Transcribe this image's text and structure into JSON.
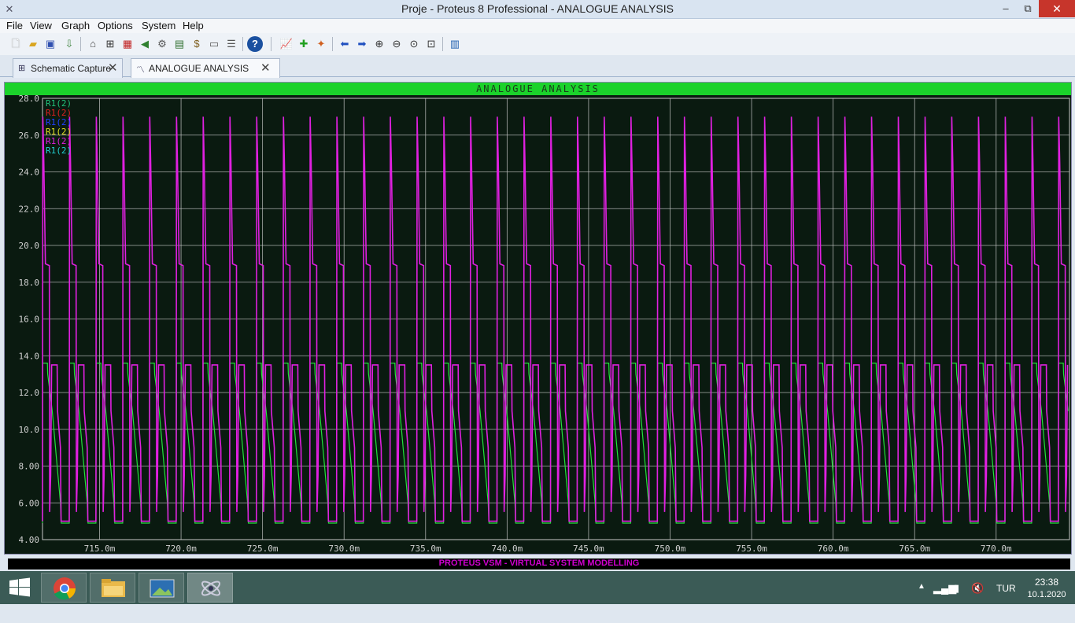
{
  "window": {
    "title": "Proje - Proteus 8 Professional - ANALOGUE ANALYSIS",
    "minimize": "–",
    "maximize": "⧉",
    "close": "✕"
  },
  "menu": [
    "File",
    "View",
    "Graph",
    "Options",
    "System",
    "Help"
  ],
  "tabs": [
    {
      "label": "Schematic Capture",
      "icon": "schematic-icon",
      "active": false
    },
    {
      "label": "ANALOGUE ANALYSIS",
      "icon": "graph-icon",
      "active": true
    }
  ],
  "graph": {
    "title": "ANALOGUE ANALYSIS",
    "background": "#0a1a10",
    "header_color": "#1bd22b",
    "grid_color": "#c8c8c8",
    "legend": [
      {
        "label": "R1(2)",
        "color": "#22c07a"
      },
      {
        "label": "R1(2)",
        "color": "#e02020"
      },
      {
        "label": "R1(2)",
        "color": "#2040ff"
      },
      {
        "label": "R1(2)",
        "color": "#e0e020"
      },
      {
        "label": "R1(2)",
        "color": "#e020e0"
      },
      {
        "label": "R1(2)",
        "color": "#20d0d0"
      }
    ]
  },
  "chart_data": {
    "type": "line",
    "title": "ANALOGUE ANALYSIS",
    "xlim": [
      711.5,
      774.5
    ],
    "ylim": [
      4.0,
      28.0
    ],
    "x_ticks": [
      715,
      720,
      725,
      730,
      735,
      740,
      745,
      750,
      755,
      760,
      765,
      770
    ],
    "x_tick_labels": [
      "715.0m",
      "720.0m",
      "725.0m",
      "730.0m",
      "735.0m",
      "740.0m",
      "745.0m",
      "750.0m",
      "755.0m",
      "760.0m",
      "765.0m",
      "770.0m"
    ],
    "y_ticks": [
      4,
      6,
      8,
      10,
      12,
      14,
      16,
      18,
      20,
      22,
      24,
      26,
      28
    ],
    "y_tick_labels": [
      "4.00",
      "6.00",
      "8.00",
      "10.0",
      "12.0",
      "14.0",
      "16.0",
      "18.0",
      "20.0",
      "22.0",
      "24.0",
      "26.0",
      "28.0"
    ],
    "period": 1.64,
    "series": [
      {
        "name": "R1(2)",
        "color": "#e020e0",
        "levels": {
          "peak": 27.0,
          "plateau": 18.9,
          "low": 5.0
        }
      },
      {
        "name": "R1(2)",
        "color": "#22e03a",
        "levels": {
          "high": 13.6,
          "spike": 13.0,
          "low": 4.9
        }
      }
    ],
    "grid": true,
    "legend_position": "top-left"
  },
  "status": {
    "text": "PROTEUS VSM - VIRTUAL SYSTEM MODELLING"
  },
  "taskbar": {
    "apps": [
      "chrome-icon",
      "file-explorer-icon",
      "photos-icon",
      "proteus-icon"
    ],
    "language": "TUR",
    "time": "23:38",
    "date": "10.1.2020"
  }
}
